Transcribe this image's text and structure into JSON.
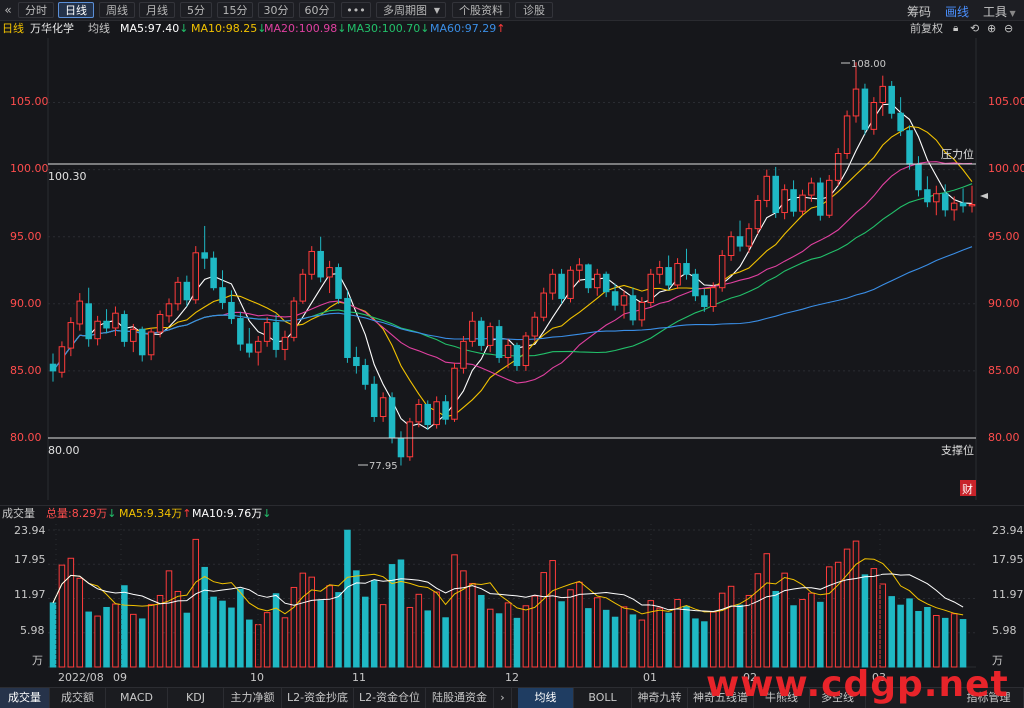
{
  "toolbar": {
    "back_icon": "«",
    "tabs": [
      "分时",
      "日线",
      "周线",
      "月线",
      "5分",
      "15分",
      "30分",
      "60分"
    ],
    "more": "•••",
    "multi": "多周期图",
    "stock_info": "个股资料",
    "diagnose": "诊股",
    "right": [
      "筹码",
      "画线",
      "工具"
    ]
  },
  "info": {
    "period": "日线",
    "name": "万华化学",
    "ma_label": "均线",
    "ma5": "MA5:97.40",
    "ma10": "MA10:98.25",
    "ma20": "MA20:100.98",
    "ma30": "MA30:100.70",
    "ma60": "MA60:97.29",
    "adjust": "前复权"
  },
  "colors": {
    "up": "#ff3b3b",
    "down": "#1fb8c4",
    "ma5": "#ffffff",
    "ma10": "#f2c200",
    "ma20": "#e040a0",
    "ma30": "#22c06a",
    "ma60": "#3a8ee6"
  },
  "price_axis": [
    "105.00",
    "100.00",
    "95.00",
    "90.00",
    "85.00",
    "80.00"
  ],
  "annotations": {
    "resistance_value": "100.30",
    "resistance_label": "压力位",
    "support_value": "80.00",
    "support_label": "支撑位",
    "high": "108.00",
    "low": "77.95",
    "badge": "财"
  },
  "volume": {
    "title": "成交量",
    "total": "总量:8.29万",
    "ma5": "MA5:9.34万",
    "ma10": "MA10:9.76万",
    "axis": [
      "23.94",
      "17.95",
      "11.97",
      "5.98"
    ],
    "unit": "万"
  },
  "months": [
    "2022/08",
    "09",
    "10",
    "11",
    "12",
    "01",
    "02",
    "03"
  ],
  "bottom_tabs": [
    "成交量",
    "成交额",
    "MACD",
    "KDJ",
    "主力净额",
    "L2-资金抄底",
    "L2-资金仓位",
    "陆股通资金"
  ],
  "bottom_tabs2": [
    "均线",
    "BOLL",
    "神奇九转",
    "神奇五线谱",
    "牛熊线",
    "多空线",
    "指标管理"
  ],
  "watermark": "www.cdgp.net",
  "chart_data": {
    "type": "candlestick",
    "ylim": [
      77.95,
      108.0
    ],
    "key_levels": [
      80.0,
      100.3
    ],
    "ohlc": [
      [
        85.5,
        86.3,
        84.2,
        85.0
      ],
      [
        84.9,
        87.2,
        84.5,
        86.8
      ],
      [
        86.7,
        89.0,
        86.1,
        88.6
      ],
      [
        88.5,
        90.8,
        88.0,
        90.2
      ],
      [
        90.0,
        91.2,
        86.8,
        87.4
      ],
      [
        87.4,
        89.1,
        86.9,
        88.7
      ],
      [
        88.7,
        89.6,
        87.8,
        88.2
      ],
      [
        88.2,
        89.8,
        87.6,
        89.3
      ],
      [
        89.2,
        89.5,
        86.8,
        87.2
      ],
      [
        87.2,
        88.5,
        86.4,
        88.1
      ],
      [
        88.1,
        88.3,
        85.7,
        86.2
      ],
      [
        86.2,
        88.2,
        85.8,
        87.9
      ],
      [
        87.9,
        89.5,
        87.5,
        89.2
      ],
      [
        89.1,
        90.4,
        88.6,
        90.0
      ],
      [
        90.0,
        92.0,
        89.5,
        91.6
      ],
      [
        91.6,
        92.1,
        89.8,
        90.3
      ],
      [
        90.3,
        94.3,
        90.0,
        93.8
      ],
      [
        93.8,
        95.8,
        92.6,
        93.4
      ],
      [
        93.4,
        93.9,
        91.0,
        91.2
      ],
      [
        91.2,
        92.5,
        89.6,
        90.1
      ],
      [
        90.1,
        91.0,
        88.5,
        88.9
      ],
      [
        88.9,
        89.4,
        86.5,
        87.0
      ],
      [
        87.0,
        88.2,
        86.0,
        86.4
      ],
      [
        86.4,
        87.6,
        85.4,
        87.2
      ],
      [
        87.2,
        89.0,
        86.8,
        88.6
      ],
      [
        88.6,
        89.2,
        86.0,
        86.6
      ],
      [
        86.6,
        88.0,
        85.8,
        87.5
      ],
      [
        87.5,
        90.5,
        87.2,
        90.2
      ],
      [
        90.2,
        92.6,
        90.0,
        92.2
      ],
      [
        92.2,
        94.3,
        91.8,
        93.9
      ],
      [
        93.9,
        95.0,
        91.6,
        92.0
      ],
      [
        92.0,
        93.2,
        90.8,
        92.7
      ],
      [
        92.7,
        93.0,
        90.0,
        90.4
      ],
      [
        90.4,
        91.0,
        85.6,
        86.0
      ],
      [
        86.0,
        86.8,
        84.8,
        85.4
      ],
      [
        85.4,
        85.9,
        83.6,
        84.0
      ],
      [
        84.0,
        84.6,
        81.2,
        81.6
      ],
      [
        81.6,
        83.4,
        81.2,
        83.0
      ],
      [
        83.0,
        83.4,
        79.6,
        80.0
      ],
      [
        80.0,
        80.5,
        77.95,
        78.6
      ],
      [
        78.6,
        81.5,
        78.3,
        81.2
      ],
      [
        81.2,
        82.9,
        80.8,
        82.5
      ],
      [
        82.5,
        82.8,
        80.6,
        81.0
      ],
      [
        81.0,
        83.1,
        80.7,
        82.7
      ],
      [
        82.7,
        83.2,
        81.0,
        81.4
      ],
      [
        81.4,
        85.6,
        81.2,
        85.2
      ],
      [
        85.2,
        87.6,
        84.8,
        87.2
      ],
      [
        87.2,
        89.4,
        86.8,
        88.7
      ],
      [
        88.7,
        89.0,
        86.5,
        86.9
      ],
      [
        86.9,
        88.6,
        86.4,
        88.3
      ],
      [
        88.3,
        88.8,
        85.6,
        86.0
      ],
      [
        86.0,
        87.4,
        85.2,
        86.9
      ],
      [
        86.9,
        87.1,
        85.0,
        85.4
      ],
      [
        85.4,
        87.9,
        85.0,
        87.6
      ],
      [
        87.6,
        89.4,
        87.2,
        89.0
      ],
      [
        89.0,
        91.2,
        88.7,
        90.8
      ],
      [
        90.8,
        92.6,
        90.3,
        92.2
      ],
      [
        92.2,
        92.6,
        90.0,
        90.4
      ],
      [
        90.4,
        92.8,
        90.1,
        92.5
      ],
      [
        92.5,
        93.4,
        91.6,
        92.9
      ],
      [
        92.9,
        93.0,
        90.8,
        91.2
      ],
      [
        91.2,
        92.6,
        90.6,
        92.2
      ],
      [
        92.2,
        92.4,
        90.5,
        90.9
      ],
      [
        90.9,
        91.5,
        89.5,
        89.9
      ],
      [
        89.9,
        91.0,
        88.9,
        90.6
      ],
      [
        90.6,
        91.2,
        88.4,
        88.8
      ],
      [
        88.8,
        90.5,
        88.3,
        90.1
      ],
      [
        90.1,
        92.6,
        89.8,
        92.2
      ],
      [
        92.2,
        93.2,
        91.5,
        92.7
      ],
      [
        92.7,
        93.6,
        91.0,
        91.4
      ],
      [
        91.4,
        93.4,
        91.1,
        93.0
      ],
      [
        93.0,
        94.1,
        91.8,
        92.2
      ],
      [
        92.2,
        92.6,
        90.2,
        90.6
      ],
      [
        90.6,
        91.1,
        89.4,
        89.8
      ],
      [
        89.8,
        91.6,
        89.4,
        91.2
      ],
      [
        91.2,
        94.0,
        90.9,
        93.6
      ],
      [
        93.6,
        95.4,
        93.2,
        95.0
      ],
      [
        95.0,
        96.2,
        93.9,
        94.3
      ],
      [
        94.3,
        96.0,
        93.8,
        95.6
      ],
      [
        95.6,
        98.1,
        95.2,
        97.7
      ],
      [
        97.7,
        100.0,
        97.2,
        99.5
      ],
      [
        99.5,
        100.2,
        96.4,
        96.8
      ],
      [
        96.8,
        98.9,
        96.3,
        98.5
      ],
      [
        98.5,
        99.2,
        96.5,
        96.9
      ],
      [
        96.9,
        98.5,
        96.6,
        98.1
      ],
      [
        98.1,
        99.4,
        97.6,
        99.0
      ],
      [
        99.0,
        99.4,
        96.2,
        96.6
      ],
      [
        96.6,
        99.6,
        96.4,
        99.2
      ],
      [
        99.2,
        101.6,
        98.8,
        101.2
      ],
      [
        101.2,
        104.4,
        100.8,
        104.0
      ],
      [
        104.0,
        108.0,
        103.5,
        106.0
      ],
      [
        106.0,
        106.4,
        102.6,
        103.0
      ],
      [
        103.0,
        105.4,
        102.6,
        105.0
      ],
      [
        105.0,
        107.0,
        104.0,
        106.2
      ],
      [
        106.2,
        106.6,
        103.8,
        104.2
      ],
      [
        104.2,
        105.4,
        102.5,
        102.9
      ],
      [
        102.9,
        103.3,
        100.0,
        100.4
      ],
      [
        100.4,
        101.0,
        98.0,
        98.5
      ],
      [
        98.5,
        99.5,
        97.2,
        97.6
      ],
      [
        97.6,
        98.8,
        96.6,
        98.2
      ],
      [
        98.2,
        98.9,
        96.5,
        97.0
      ],
      [
        97.0,
        98.0,
        96.2,
        97.5
      ],
      [
        97.5,
        98.6,
        96.8,
        97.3
      ],
      [
        97.3,
        98.8,
        96.8,
        97.4
      ]
    ],
    "volume": [
      11.2,
      17.8,
      19.0,
      15.5,
      9.6,
      8.9,
      10.4,
      11.0,
      14.2,
      9.2,
      8.4,
      10.9,
      12.5,
      16.8,
      13.2,
      9.4,
      22.3,
      17.4,
      12.2,
      11.5,
      10.3,
      13.6,
      8.2,
      7.4,
      9.5,
      12.8,
      8.6,
      13.9,
      16.4,
      15.7,
      11.6,
      14.2,
      13.0,
      23.9,
      16.8,
      12.2,
      15.1,
      10.9,
      17.9,
      18.7,
      10.4,
      12.7,
      9.8,
      13.1,
      8.6,
      19.6,
      16.8,
      14.6,
      12.5,
      10.1,
      9.3,
      11.2,
      8.5,
      10.7,
      12.4,
      16.5,
      18.6,
      11.4,
      13.5,
      14.8,
      10.2,
      12.1,
      9.9,
      8.7,
      10.5,
      9.1,
      8.2,
      11.6,
      10.3,
      9.4,
      11.8,
      10.6,
      8.4,
      7.9,
      9.6,
      12.9,
      14.1,
      10.8,
      12.5,
      16.3,
      19.8,
      13.2,
      16.4,
      10.7,
      11.8,
      12.9,
      11.3,
      17.5,
      18.3,
      20.6,
      22.0,
      16.1,
      17.2,
      14.5,
      12.3,
      10.8,
      11.9,
      9.7,
      10.4,
      9.0,
      8.5,
      9.3,
      8.29
    ]
  }
}
